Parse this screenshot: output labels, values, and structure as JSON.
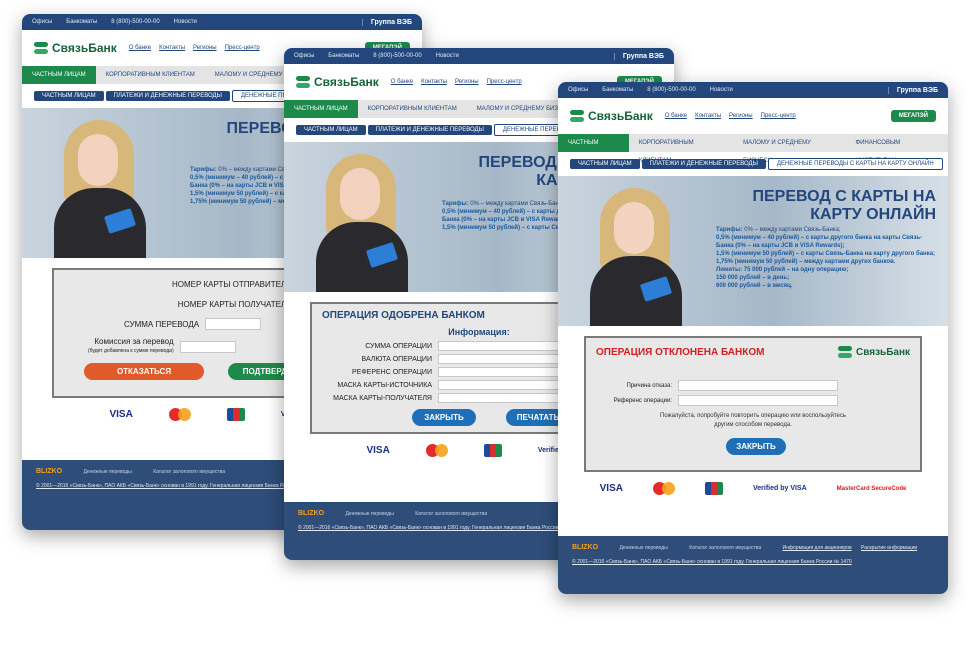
{
  "header": {
    "topbar": [
      "Офисы",
      "Банкоматы",
      "8 (800)-500-00-00",
      "Новости"
    ],
    "group": "Группа ВЭБ",
    "logo": "СвязьБанк",
    "nav": [
      "О банке",
      "Контакты",
      "Регионы",
      "Пресс-центр"
    ],
    "mega": "МЕГАПЭЙ",
    "menu": [
      "ЧАСТНЫМ ЛИЦАМ",
      "КОРПОРАТИВНЫМ КЛИЕНТАМ",
      "МАЛОМУ И СРЕДНЕМУ БИЗНЕСУ",
      "ФИНАНСОВЫМ ИНСТИТУТАМ"
    ],
    "crumbs": [
      "ЧАСТНЫМ ЛИЦАМ",
      "ПЛАТЕЖИ И ДЕНЕЖНЫЕ ПЕРЕВОДЫ",
      "ДЕНЕЖНЫЕ ПЕРЕВОДЫ С КАРТЫ НА КАРТУ ОНЛАЙН"
    ]
  },
  "banner": {
    "title": "ПЕРЕВОД С КАРТЫ НА КАРТУ ОНЛАЙН",
    "tariffs_label": "Тарифы:",
    "t1": "0% – между картами Связь-Банка;",
    "t2": "0,5% (минимум – 40 рублей) – с карты другого банка на карты Связь-Банка (0% – на карты JCB и VISA Rewards);",
    "t3": "1,5% (минимум 50 рублей) – с карты Связь-Банка на карту другого банка;",
    "t4": "1,75% (минимум 50 рублей) – между картами других банков.",
    "limits_label": "Лимиты:",
    "l1": "75 000 рублей – на одну операцию;",
    "l2": "150 000 рублей – в день;",
    "l3": "600 000 рублей – в месяц."
  },
  "form": {
    "sender": "НОМЕР КАРТЫ ОТПРАВИТЕЛЯ",
    "receiver": "НОМЕР КАРТЫ ПОЛУЧАТЕЛЯ",
    "amount": "СУММА ПЕРЕВОДА",
    "fee": "Комиссия за перевод",
    "fee_note": "(будет добавлена к сумме перевода)",
    "cancel": "ОТКАЗАТЬСЯ",
    "confirm": "ПОДТВЕРДИТЬ"
  },
  "approved": {
    "title": "ОПЕРАЦИЯ ОДОБРЕНА БАНКОМ",
    "info": "Информация:",
    "fields": [
      "СУММА ОПЕРАЦИИ",
      "ВАЛЮТА ОПЕРАЦИИ",
      "РЕФЕРЕНС ОПЕРАЦИИ",
      "МАСКА КАРТЫ-ИСТОЧНИКА",
      "МАСКА КАРТЫ-ПОЛУЧАТЕЛЯ"
    ],
    "close": "ЗАКРЫТЬ",
    "print": "ПЕЧАТАТЬ"
  },
  "declined": {
    "title": "ОПЕРАЦИЯ ОТКЛОНЕНА БАНКОМ",
    "reason": "Причина отказа:",
    "ref": "Референс операции:",
    "msg": "Пожалуйста, попробуйте повторить операцию или воспользуйтесь другим способом перевода.",
    "close": "ЗАКРЫТЬ"
  },
  "payments": [
    "VISA",
    "MasterCard",
    "JCB",
    "Verified by VISA",
    "MasterCard SecureCode"
  ],
  "footer": {
    "brand": "BLIZKO",
    "l1": "Денежные переводы",
    "l2": "Каталог залогового имущества",
    "l3": "Информация для акционеров",
    "l4": "Раскрытие информации",
    "copyright": "© 2001—2016 «Связь-Банк», ПАО АКБ «Связь-Банк» основан в 1991 году. Генеральная лицензия Банка России № 1470"
  }
}
